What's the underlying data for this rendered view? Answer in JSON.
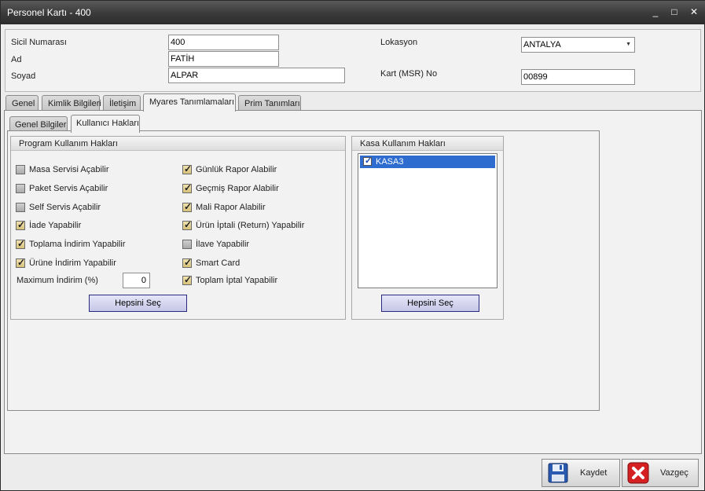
{
  "window": {
    "title": "Personel Kartı - 400",
    "minimize": "_",
    "maximize": "□",
    "close": "✕"
  },
  "header": {
    "sicil_label": "Sicil Numarası",
    "sicil_value": "400",
    "ad_label": "Ad",
    "ad_value": "FATİH",
    "soyad_label": "Soyad",
    "soyad_value": "ALPAR",
    "lokasyon_label": "Lokasyon",
    "lokasyon_value": "ANTALYA",
    "kart_label": "Kart (MSR) No",
    "kart_value": "00899"
  },
  "tabs": [
    {
      "label": "Genel"
    },
    {
      "label": "Kimlik Bilgileri"
    },
    {
      "label": "İletişim"
    },
    {
      "label": "Myares Tanımlamaları"
    },
    {
      "label": "Prim Tanımları"
    }
  ],
  "subtabs": [
    {
      "label": "Genel Bilgiler"
    },
    {
      "label": "Kullanıcı Hakları"
    }
  ],
  "program_group": {
    "title": "Program Kullanım Hakları",
    "left": [
      {
        "label": "Masa Servisi Açabilir",
        "checked": false
      },
      {
        "label": "Paket Servis Açabilir",
        "checked": false
      },
      {
        "label": "Self Servis Açabilir",
        "checked": false
      },
      {
        "label": "İade Yapabilir",
        "checked": true
      },
      {
        "label": "Toplama İndirim Yapabilir",
        "checked": true
      },
      {
        "label": "Ürüne İndirim Yapabilir",
        "checked": true
      }
    ],
    "right": [
      {
        "label": "Günlük Rapor Alabilir",
        "checked": true
      },
      {
        "label": "Geçmiş Rapor Alabilir",
        "checked": true
      },
      {
        "label": "Mali Rapor Alabilir",
        "checked": true
      },
      {
        "label": "Ürün İptali (Return) Yapabilir",
        "checked": true
      },
      {
        "label": "İlave Yapabilir",
        "checked": false
      },
      {
        "label": "Smart Card",
        "checked": true
      },
      {
        "label": "Toplam İptal Yapabilir",
        "checked": true
      }
    ],
    "max_discount_label": "Maximum İndirim (%)",
    "max_discount_value": "0",
    "select_all": "Hepsini Seç"
  },
  "kasa_group": {
    "title": "Kasa Kullanım Hakları",
    "items": [
      {
        "label": "KASA3",
        "checked": true
      }
    ],
    "select_all": "Hepsini Seç"
  },
  "footer": {
    "save": "Kaydet",
    "cancel": "Vazgeç"
  },
  "colors": {
    "titlebar": "#3c3c3c",
    "selection": "#2e6dcf",
    "button_border": "#2a2a80",
    "cancel_red": "#d42020",
    "save_blue": "#2a5ab0"
  }
}
